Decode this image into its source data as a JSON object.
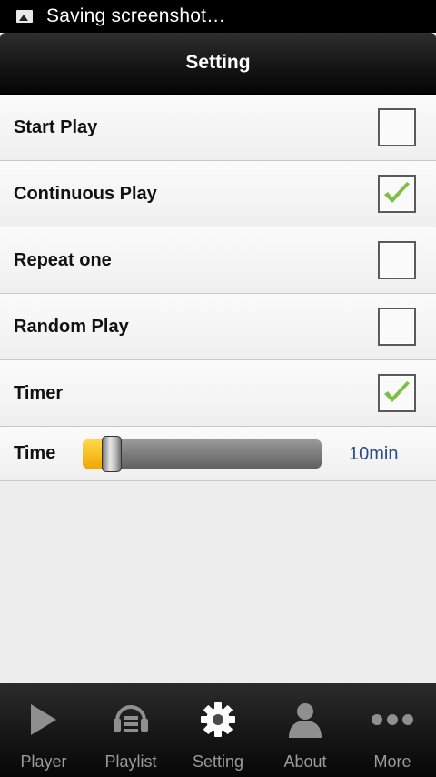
{
  "status_bar": {
    "text": "Saving screenshot…",
    "icon": "image-icon"
  },
  "header": {
    "title": "Setting"
  },
  "settings": [
    {
      "label": "Start Play",
      "checked": false
    },
    {
      "label": "Continuous Play",
      "checked": true
    },
    {
      "label": "Repeat one",
      "checked": false
    },
    {
      "label": "Random Play",
      "checked": false
    },
    {
      "label": "Timer",
      "checked": true
    }
  ],
  "time": {
    "label": "Time",
    "value": "10min",
    "slider_fraction": 0.12
  },
  "colors": {
    "check": "#7cc142",
    "slider_fill": "#f0b400",
    "time_value": "#2a4a8a"
  },
  "nav": [
    {
      "label": "Player",
      "icon": "play-icon",
      "active": false
    },
    {
      "label": "Playlist",
      "icon": "playlist-icon",
      "active": false
    },
    {
      "label": "Setting",
      "icon": "gear-icon",
      "active": true
    },
    {
      "label": "About",
      "icon": "person-icon",
      "active": false
    },
    {
      "label": "More",
      "icon": "more-dots-icon",
      "active": false
    }
  ]
}
